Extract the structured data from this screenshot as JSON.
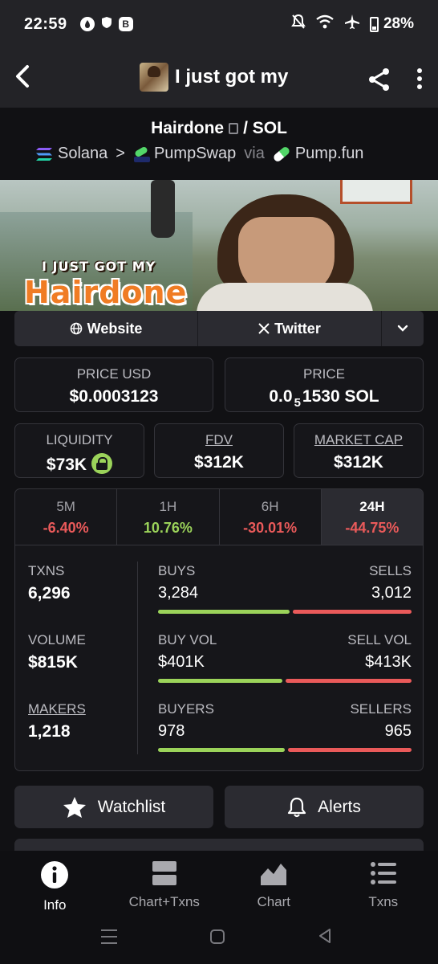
{
  "status_bar": {
    "time": "22:59",
    "battery": "28%",
    "badge_letter": "B"
  },
  "header": {
    "title": "I just got my"
  },
  "pair": {
    "base": "Hairdone",
    "separator": "/",
    "quote": "SOL",
    "chain": "Solana",
    "chevron": ">",
    "dex": "PumpSwap",
    "via": "via",
    "launchpad": "Pump.fun"
  },
  "banner": {
    "caption_top": "I JUST GOT MY",
    "caption_main": "Hairdone"
  },
  "links": {
    "website": "Website",
    "twitter": "Twitter"
  },
  "price": {
    "usd_label": "PRICE USD",
    "usd_value": "$0.0003123",
    "native_label": "PRICE",
    "native_prefix": "0.0",
    "native_sub": "5",
    "native_rest": "1530 SOL"
  },
  "metrics": {
    "liquidity_label": "LIQUIDITY",
    "liquidity_value": "$73K",
    "fdv_label": "FDV",
    "fdv_value": "$312K",
    "mcap_label": "MARKET CAP",
    "mcap_value": "$312K"
  },
  "timeframes": [
    {
      "label": "5M",
      "change": "-6.40%"
    },
    {
      "label": "1H",
      "change": "10.76%"
    },
    {
      "label": "6H",
      "change": "-30.01%"
    },
    {
      "label": "24H",
      "change": "-44.75%"
    }
  ],
  "stats": {
    "txns_label": "TXNS",
    "txns_value": "6,296",
    "buys_label": "BUYS",
    "buys_value": "3,284",
    "sells_label": "SELLS",
    "sells_value": "3,012",
    "volume_label": "VOLUME",
    "volume_value": "$815K",
    "buyvol_label": "BUY VOL",
    "buyvol_value": "$401K",
    "sellvol_label": "SELL VOL",
    "sellvol_value": "$413K",
    "makers_label": "MAKERS",
    "makers_value": "1,218",
    "buyers_label": "BUYERS",
    "buyers_value": "978",
    "sellers_label": "SELLERS",
    "sellers_value": "965"
  },
  "actions": {
    "watchlist": "Watchlist",
    "alerts": "Alerts"
  },
  "bottom_nav": [
    {
      "label": "Info",
      "icon": "info-icon"
    },
    {
      "label": "Chart+Txns",
      "icon": "split-view-icon"
    },
    {
      "label": "Chart",
      "icon": "area-chart-icon"
    },
    {
      "label": "Txns",
      "icon": "list-icon"
    }
  ],
  "colors": {
    "positive": "#9bd35a",
    "negative": "#ea5a5a",
    "background": "#111114",
    "panel": "#2b2b31"
  }
}
